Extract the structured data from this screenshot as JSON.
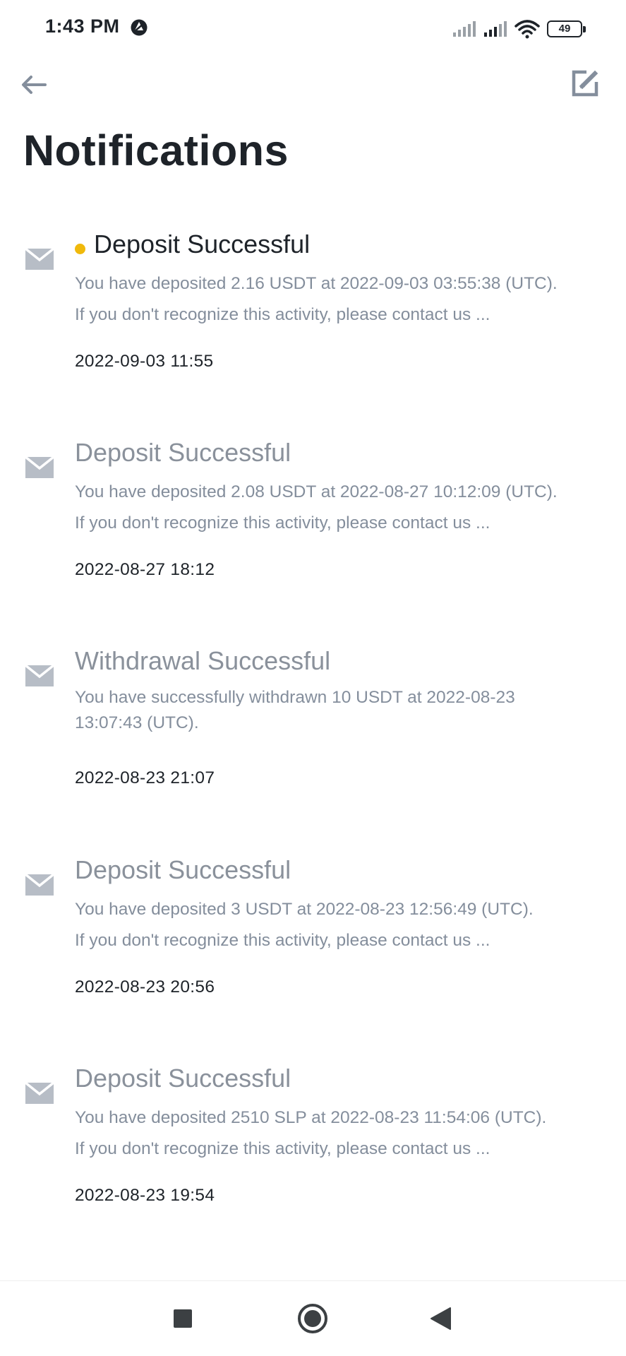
{
  "status_bar": {
    "time": "1:43 PM",
    "battery": "49",
    "icons": [
      "app-notification-icon",
      "signal-icon",
      "signal-icon",
      "wifi-icon",
      "battery-icon"
    ]
  },
  "header": {
    "back_icon": "arrow-left-icon",
    "action_icon": "edit-icon",
    "title": "Notifications"
  },
  "colors": {
    "unread_dot": "#f0b90b",
    "title_read": "#8a919b",
    "title_unread": "#1e2329",
    "body": "#848e9c"
  },
  "notifications": [
    {
      "title": "Deposit Successful",
      "unread": true,
      "line1": "You have deposited 2.16 USDT at 2022-09-03 03:55:38 (UTC).",
      "line2": "If you don't recognize this activity, please contact us ...",
      "timestamp": "2022-09-03 11:55"
    },
    {
      "title": "Deposit Successful",
      "unread": false,
      "line1": "You have deposited 2.08 USDT at 2022-08-27 10:12:09 (UTC).",
      "line2": "If you don't recognize this activity, please contact us ...",
      "timestamp": "2022-08-27 18:12"
    },
    {
      "title": "Withdrawal Successful",
      "unread": false,
      "line1": "You have successfully withdrawn 10 USDT at 2022-08-23 13:07:43 (UTC).",
      "line2": "",
      "timestamp": "2022-08-23 21:07"
    },
    {
      "title": "Deposit Successful",
      "unread": false,
      "line1": "You have deposited 3 USDT at 2022-08-23 12:56:49 (UTC).",
      "line2": "If you don't recognize this activity, please contact us ...",
      "timestamp": "2022-08-23 20:56"
    },
    {
      "title": "Deposit Successful",
      "unread": false,
      "line1": "You have deposited 2510 SLP at 2022-08-23 11:54:06 (UTC).",
      "line2": "If you don't recognize this activity, please contact us ...",
      "timestamp": "2022-08-23 19:54"
    }
  ],
  "nav_bar": {
    "icons": [
      "recents-square-icon",
      "home-circle-icon",
      "back-triangle-icon"
    ]
  }
}
